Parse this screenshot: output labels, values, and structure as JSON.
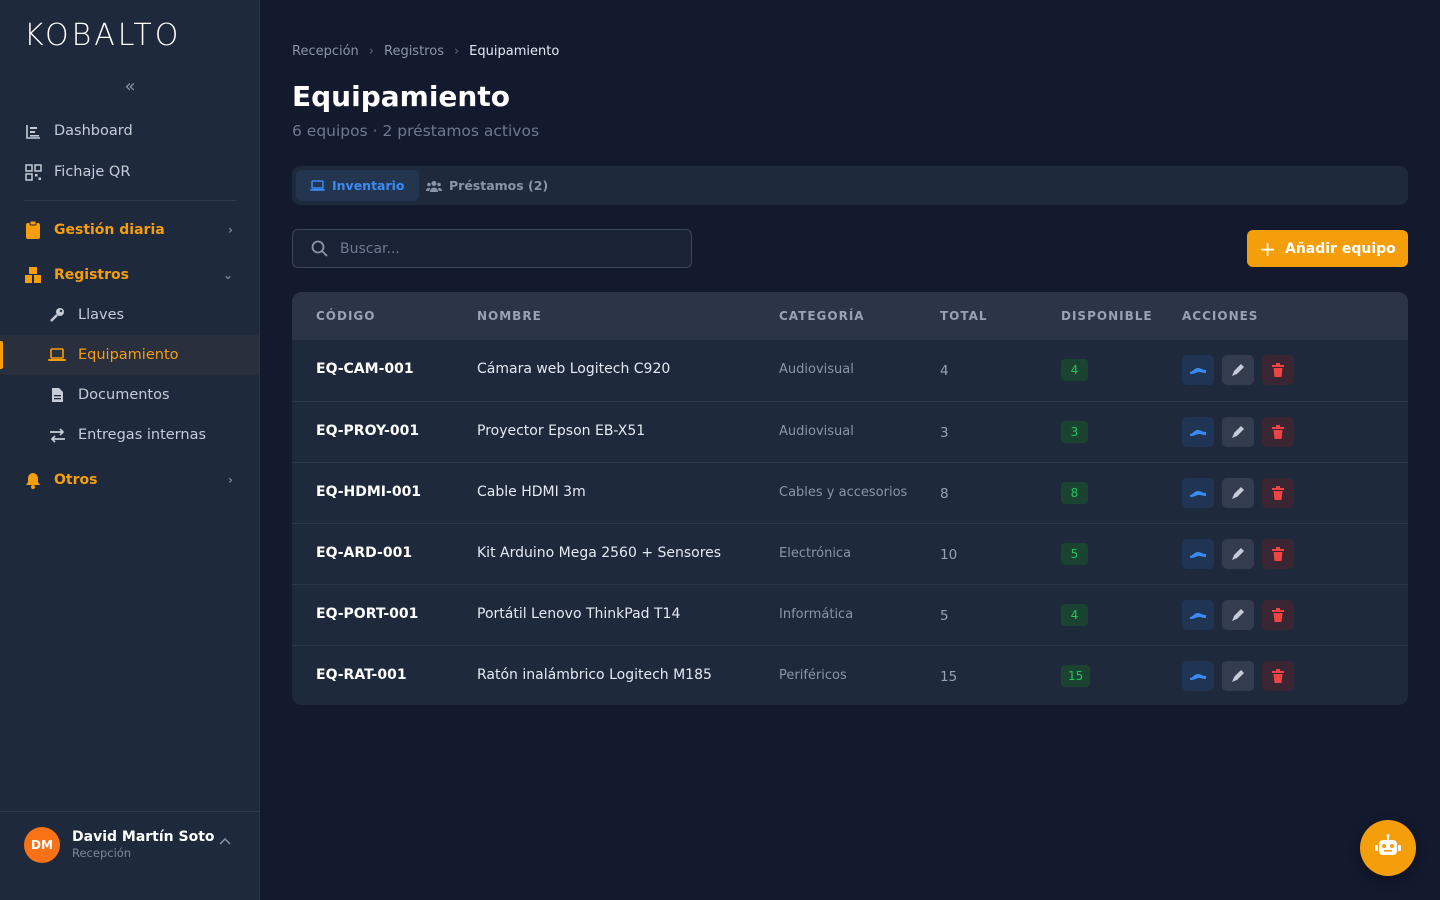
{
  "brand": {
    "logo": "KOBALTO",
    "collapse_icon": "«"
  },
  "sidebar": {
    "items": [
      {
        "label": "Dashboard",
        "icon": "chart-bars-icon"
      },
      {
        "label": "Fichaje QR",
        "icon": "qr-icon"
      }
    ],
    "groups": [
      {
        "label": "Gestión diaria",
        "icon": "clipboard-icon",
        "chevron": "›"
      },
      {
        "label": "Registros",
        "icon": "boxes-icon",
        "chevron": "⌄"
      }
    ],
    "sub_items": [
      {
        "label": "Llaves",
        "icon": "key-icon"
      },
      {
        "label": "Equipamiento",
        "icon": "laptop-icon",
        "active": true
      },
      {
        "label": "Documentos",
        "icon": "file-icon"
      },
      {
        "label": "Entregas internas",
        "icon": "exchange-icon"
      }
    ],
    "others": {
      "label": "Otros",
      "icon": "bell-icon",
      "chevron": "›"
    }
  },
  "user": {
    "initials": "DM",
    "name": "David Martín Soto",
    "role": "Recepción"
  },
  "breadcrumb": [
    "Recepción",
    "Registros",
    "Equipamiento"
  ],
  "breadcrumb_sep": "›",
  "page": {
    "title": "Equipamiento",
    "subtitle": "6 equipos · 2 préstamos activos"
  },
  "tabs": [
    {
      "label": "Inventario",
      "active": true
    },
    {
      "label": "Préstamos (2)",
      "active": false
    }
  ],
  "search": {
    "placeholder": "Buscar...",
    "value": ""
  },
  "add_button": {
    "label": "Añadir equipo",
    "icon": "+"
  },
  "table": {
    "headers": [
      "CÓDIGO",
      "NOMBRE",
      "CATEGORÍA",
      "TOTAL",
      "DISPONIBLE",
      "ACCIONES"
    ],
    "rows": [
      {
        "code": "EQ-CAM-001",
        "name": "Cámara web Logitech C920",
        "category": "Audiovisual",
        "total": "4",
        "available": "4"
      },
      {
        "code": "EQ-PROY-001",
        "name": "Proyector Epson EB-X51",
        "category": "Audiovisual",
        "total": "3",
        "available": "3"
      },
      {
        "code": "EQ-HDMI-001",
        "name": "Cable HDMI 3m",
        "category": "Cables y accesorios",
        "total": "8",
        "available": "8"
      },
      {
        "code": "EQ-ARD-001",
        "name": "Kit Arduino Mega 2560 + Sensores",
        "category": "Electrónica",
        "total": "10",
        "available": "5"
      },
      {
        "code": "EQ-PORT-001",
        "name": "Portátil Lenovo ThinkPad T14",
        "category": "Informática",
        "total": "5",
        "available": "4"
      },
      {
        "code": "EQ-RAT-001",
        "name": "Ratón inalámbrico Logitech M185",
        "category": "Periféricos",
        "total": "15",
        "available": "15"
      }
    ]
  },
  "colors": {
    "accent": "#f59e0b",
    "primary": "#3b8bf6",
    "success": "#22c55e",
    "danger": "#ef4444",
    "background": "#131a2e",
    "sidebar": "#1e293b"
  }
}
